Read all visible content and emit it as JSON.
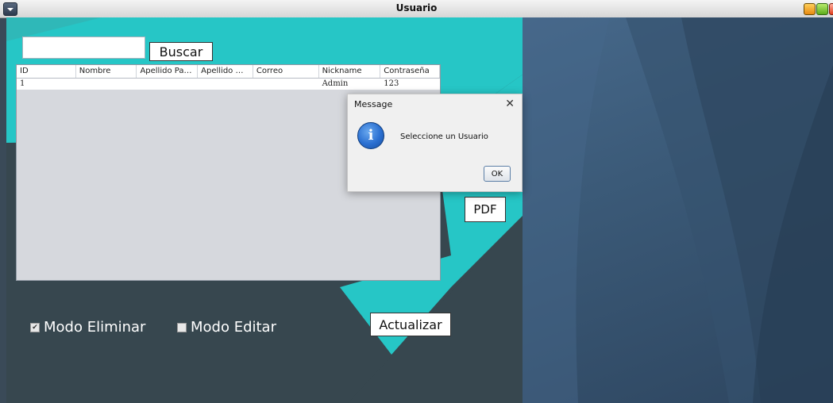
{
  "window": {
    "title": "Usuario"
  },
  "search": {
    "button_label": "Buscar",
    "value": ""
  },
  "table": {
    "columns": [
      "ID",
      "Nombre",
      "Apellido Pater...",
      "Apellido Mater...",
      "Correo",
      "Nickname",
      "Contraseña"
    ],
    "rows": [
      [
        "1",
        "",
        "",
        "",
        "",
        "Admin",
        "123"
      ]
    ]
  },
  "buttons": {
    "pdf": "PDF",
    "actualizar": "Actualizar"
  },
  "checkboxes": {
    "eliminar": {
      "label": "Modo Eliminar",
      "checked": true
    },
    "editar": {
      "label": "Modo Editar",
      "checked": false
    }
  },
  "dialog": {
    "title": "Message",
    "message": "Seleccione un Usuario",
    "ok_label": "OK",
    "icon": "info-icon"
  },
  "colors": {
    "teal": "#26c6c6",
    "dark": "#37474f",
    "right_bg": "#3b5a78"
  }
}
